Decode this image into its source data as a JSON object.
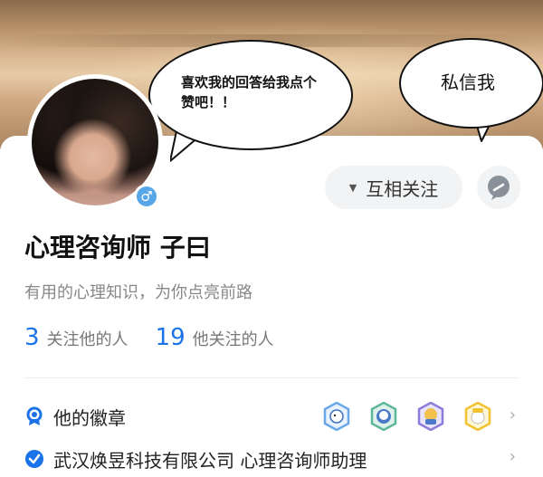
{
  "bubbles": {
    "left_text": "喜欢我的回答给我点个赞吧！！",
    "right_text": "私信我"
  },
  "profile": {
    "name": "心理咨询师 子曰",
    "bio": "有用的心理知识，为你点亮前路",
    "gender_symbol": "♂",
    "follow_button": "互相关注",
    "follow_dropdown_symbol": "▼"
  },
  "stats": {
    "followers_count": "3",
    "followers_label": "关注他的人",
    "following_count": "19",
    "following_label": "他关注的人"
  },
  "rows": {
    "badges_label": "他的徽章",
    "company_label": "武汉焕昱科技有限公司 心理咨询师助理"
  },
  "colors": {
    "accent": "#1a73e8",
    "gender": "#57a6e8",
    "chat_icon": "#8a9099"
  },
  "icons": {
    "chat": "chat-bubble-icon",
    "badge_row": "ribbon-icon",
    "company_row": "verified-check-icon",
    "chevron": "chevron-right-icon"
  }
}
